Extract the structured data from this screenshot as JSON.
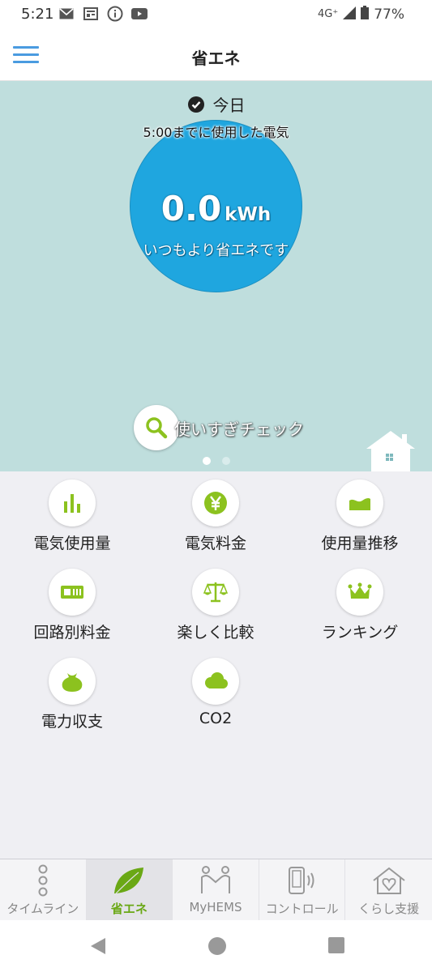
{
  "status_bar": {
    "time": "5:21",
    "network": "4G⁺",
    "battery": "77%"
  },
  "header": {
    "title": "省エネ"
  },
  "hero": {
    "period_label": "今日",
    "usage_caption": "5:00までに使用した電気",
    "value": "0.0",
    "unit": "kWh",
    "status_message": "いつもより省エネです",
    "check_button_label": "使いすぎチェック",
    "page_count": 2,
    "active_page": 1
  },
  "menu": [
    {
      "label": "電気使用量",
      "icon": "bar-chart-icon"
    },
    {
      "label": "電気料金",
      "icon": "yen-icon"
    },
    {
      "label": "使用量推移",
      "icon": "trend-icon"
    },
    {
      "label": "回路別料金",
      "icon": "breaker-icon"
    },
    {
      "label": "楽しく比較",
      "icon": "scale-icon"
    },
    {
      "label": "ランキング",
      "icon": "crown-icon"
    },
    {
      "label": "電力収支",
      "icon": "money-bag-icon"
    },
    {
      "label": "CO2",
      "icon": "cloud-icon"
    }
  ],
  "bottom_nav": [
    {
      "label": "タイムライン",
      "icon": "timeline-icon",
      "active": false
    },
    {
      "label": "省エネ",
      "icon": "leaf-icon",
      "active": true
    },
    {
      "label": "MyHEMS",
      "icon": "people-icon",
      "active": false
    },
    {
      "label": "コントロール",
      "icon": "remote-icon",
      "active": false
    },
    {
      "label": "くらし支援",
      "icon": "home-heart-icon",
      "active": false
    }
  ],
  "colors": {
    "accent_green": "#8cc21f",
    "hero_background": "#bfdedd",
    "circle_blue": "#1fa6df",
    "menu_blue": "#4a9be0"
  }
}
